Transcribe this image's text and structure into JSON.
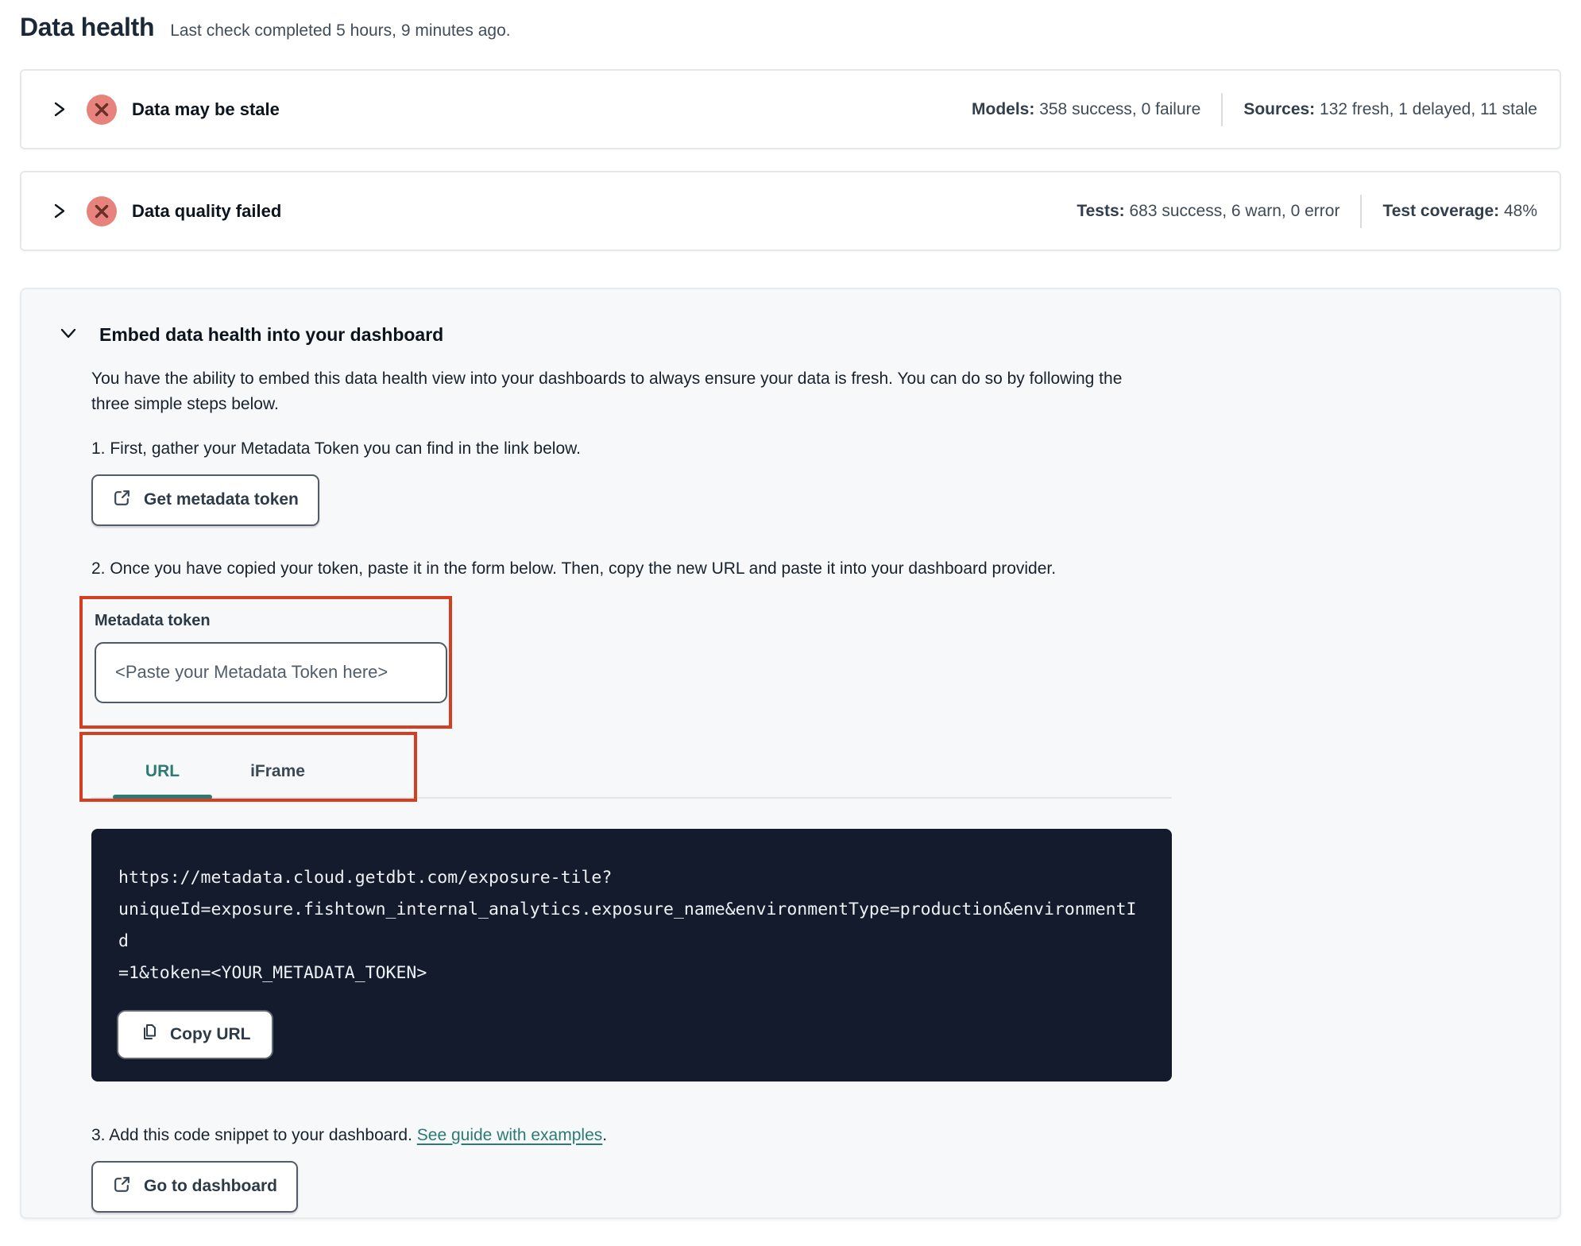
{
  "header": {
    "title": "Data health",
    "subtitle": "Last check completed 5 hours, 9 minutes ago."
  },
  "status_rows": [
    {
      "title": "Data may be stale",
      "stats": [
        {
          "label": "Models:",
          "value": " 358 success, 0 failure"
        },
        {
          "label": "Sources:",
          "value": " 132 fresh, 1 delayed, 11 stale"
        }
      ]
    },
    {
      "title": "Data quality failed",
      "stats": [
        {
          "label": "Tests:",
          "value": " 683 success, 6 warn, 0 error"
        },
        {
          "label": "Test coverage:",
          "value": " 48%"
        }
      ]
    }
  ],
  "embed": {
    "title": "Embed data health into your dashboard",
    "description": "You have the ability to embed this data health view into your dashboards to always ensure your data is fresh. You can do so by following the three simple steps below.",
    "step1": "1. First, gather your Metadata Token you can find in the link below.",
    "get_token_button": "Get metadata token",
    "step2": "2. Once you have copied your token, paste it in the form below. Then, copy the new URL and paste it into your dashboard provider.",
    "token_field": {
      "label": "Metadata token",
      "placeholder": "<Paste your Metadata Token here>"
    },
    "tabs": [
      {
        "label": "URL",
        "active": true
      },
      {
        "label": "iFrame",
        "active": false
      }
    ],
    "code": {
      "lines": [
        "https://metadata.cloud.getdbt.com/exposure-tile?",
        "uniqueId=exposure.fishtown_internal_analytics.exposure_name&environmentType=production&environmentId",
        "=1&token=<YOUR_METADATA_TOKEN>"
      ],
      "copy_button": "Copy URL"
    },
    "step3": {
      "prefix": "3. Add this code snippet to your dashboard. ",
      "link": "See guide with examples",
      "suffix": "."
    },
    "dashboard_button": "Go to dashboard"
  },
  "colors": {
    "accent_teal": "#2c7a74",
    "annotation_red": "#d63e22",
    "error_salmon": "#e6837c",
    "error_x": "#6b2d28",
    "code_background": "#141b2c"
  }
}
